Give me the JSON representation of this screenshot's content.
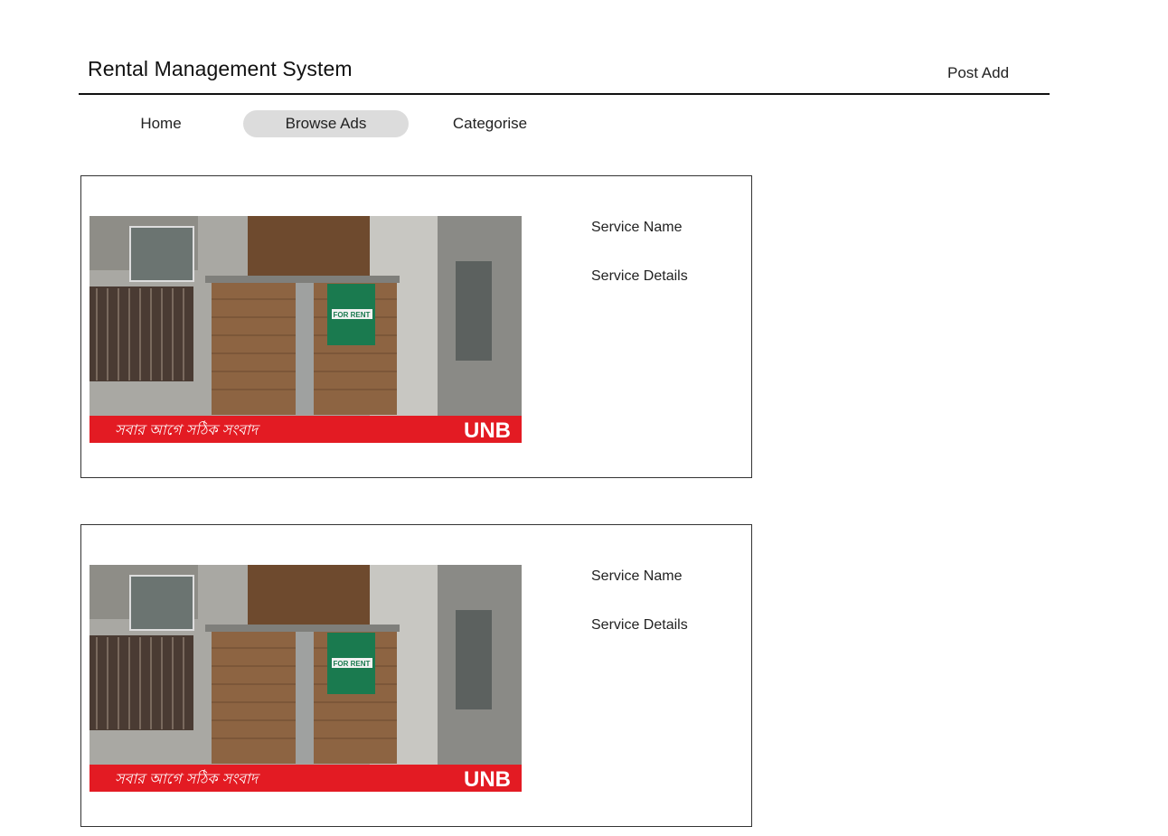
{
  "header": {
    "title": "Rental Management System",
    "post_add_label": "Post Add"
  },
  "nav": {
    "items": [
      {
        "label": "Home",
        "active": false
      },
      {
        "label": "Browse Ads",
        "active": true
      },
      {
        "label": "Categorise",
        "active": false
      }
    ]
  },
  "listings": [
    {
      "service_name": "Service Name",
      "service_details": "Service Details",
      "image": {
        "sign_text": "FOR RENT",
        "banner_text": "সবার আগে সঠিক সংবাদ",
        "brand": "UNB"
      }
    },
    {
      "service_name": "Service Name",
      "service_details": "Service Details",
      "image": {
        "sign_text": "FOR RENT",
        "banner_text": "সবার আগে সঠিক সংবাদ",
        "brand": "UNB"
      }
    }
  ],
  "colors": {
    "nav_active_bg": "#dcdcdc",
    "banner_red": "#e31b23",
    "sign_green": "#1a7a4f",
    "rule": "#111111"
  }
}
